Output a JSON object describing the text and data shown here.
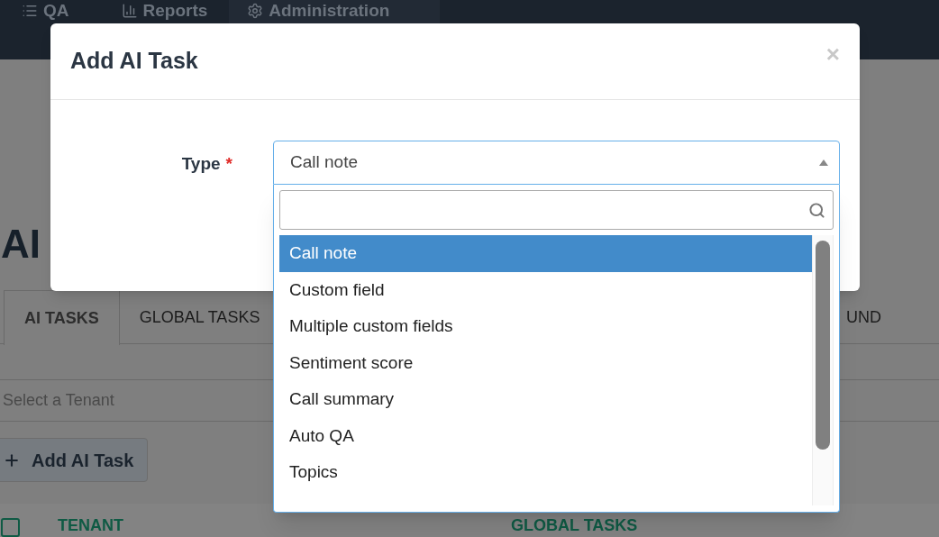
{
  "navbar": {
    "items": [
      {
        "label": "QA",
        "selected": false
      },
      {
        "label": "Reports",
        "selected": false
      },
      {
        "label": "Administration",
        "selected": true
      }
    ]
  },
  "page": {
    "title": "AI",
    "tabs": [
      {
        "label": "AI TASKS",
        "selected": true
      },
      {
        "label": "GLOBAL TASKS",
        "selected": false
      },
      {
        "label": "UND",
        "selected": false
      }
    ],
    "tenant_select": {
      "placeholder": "Select a Tenant"
    },
    "add_button": {
      "label": "Add AI Task"
    },
    "table": {
      "select_all": {
        "checked": false
      },
      "columns": [
        "TENANT",
        "GLOBAL TASKS"
      ]
    }
  },
  "modal": {
    "title": "Add AI Task",
    "close": "×",
    "type_field": {
      "label": "Type",
      "required_mark": "*",
      "value": "Call note",
      "expanded": true
    },
    "options": [
      {
        "label": "Call note",
        "selected": true
      },
      {
        "label": "Custom field",
        "selected": false
      },
      {
        "label": "Multiple custom fields",
        "selected": false
      },
      {
        "label": "Sentiment score",
        "selected": false
      },
      {
        "label": "Call summary",
        "selected": false
      },
      {
        "label": "Auto QA",
        "selected": false
      },
      {
        "label": "Topics",
        "selected": false
      }
    ]
  }
}
